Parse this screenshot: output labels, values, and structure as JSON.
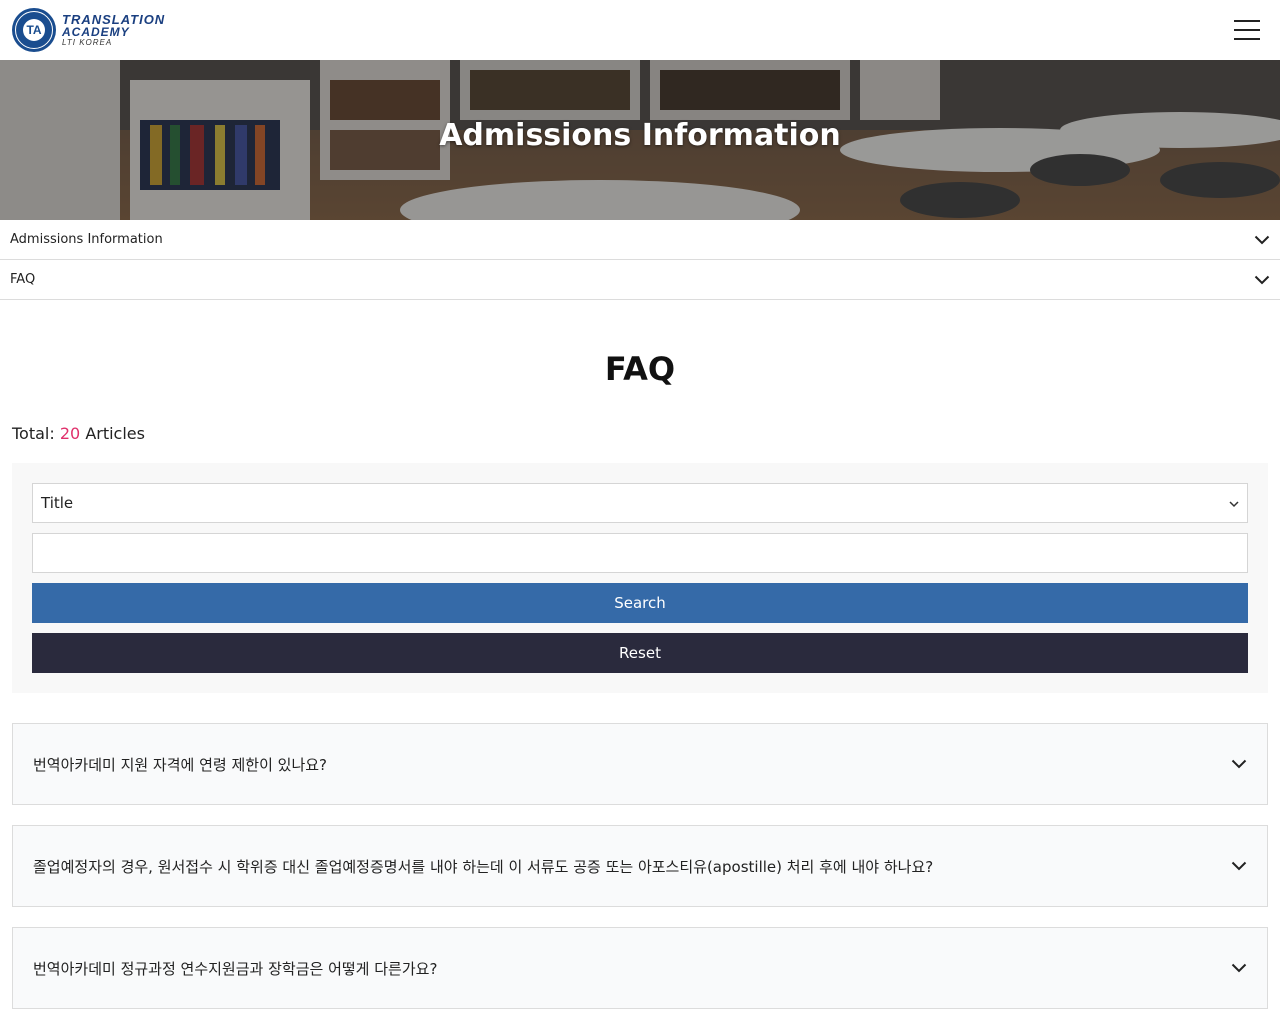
{
  "header": {
    "logo_line1": "TRANSLATION",
    "logo_line2": "ACADEMY",
    "logo_line3": "LTI KOREA",
    "logo_seal_letters": "TA",
    "menu_icon": "hamburger-menu-icon"
  },
  "hero": {
    "title": "Admissions Information"
  },
  "subnav": [
    {
      "label": "Admissions Information",
      "icon": "chevron-down-icon"
    },
    {
      "label": "FAQ",
      "icon": "chevron-down-icon"
    }
  ],
  "main": {
    "title": "FAQ",
    "total_prefix": "Total:",
    "total_count": "20",
    "total_suffix": "Articles"
  },
  "search": {
    "select_value": "Title",
    "input_value": "",
    "search_label": "Search",
    "reset_label": "Reset"
  },
  "faq_items": [
    {
      "question": "번역아카데미 지원 자격에 연령 제한이 있나요?"
    },
    {
      "question": "졸업예정자의 경우, 원서접수 시 학위증 대신 졸업예정증명서를 내야 하는데 이 서류도 공증 또는 아포스티유(apostille) 처리 후에 내야 하나요?"
    },
    {
      "question": "번역아카데미 정규과정 연수지원금과 장학금은 어떻게 다른가요?"
    }
  ],
  "colors": {
    "accent_blue": "#356aa8",
    "dark_button": "#2a2a3d",
    "count_pink": "#e0306b",
    "logo_blue": "#1a4d8f"
  }
}
